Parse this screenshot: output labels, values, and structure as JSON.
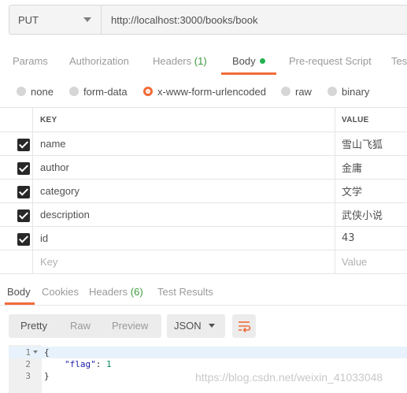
{
  "request": {
    "method": "PUT",
    "url": "http://localhost:3000/books/book"
  },
  "request_tabs": {
    "params": "Params",
    "authorization": "Authorization",
    "headers": "Headers",
    "headers_count": "(1)",
    "body": "Body",
    "prerequest": "Pre-request Script",
    "tests": "Tes"
  },
  "body_types": {
    "none": "none",
    "form_data": "form-data",
    "urlencoded": "x-www-form-urlencoded",
    "raw": "raw",
    "binary": "binary",
    "selected": "x-www-form-urlencoded"
  },
  "kv_table": {
    "key_header": "KEY",
    "value_header": "VALUE",
    "rows": [
      {
        "key": "name",
        "value": "雪山飞狐",
        "checked": true
      },
      {
        "key": "author",
        "value": "金庸",
        "checked": true
      },
      {
        "key": "category",
        "value": "文学",
        "checked": true
      },
      {
        "key": "description",
        "value": "武侠小说",
        "checked": true
      },
      {
        "key": "id",
        "value": "43",
        "checked": true
      }
    ],
    "placeholder_key": "Key",
    "placeholder_value": "Value"
  },
  "response_tabs": {
    "body": "Body",
    "cookies": "Cookies",
    "headers": "Headers",
    "headers_count": "(6)",
    "test_results": "Test Results"
  },
  "response_toolbar": {
    "pretty": "Pretty",
    "raw": "Raw",
    "preview": "Preview",
    "format": "JSON",
    "wrap_icon": "wrap-lines-icon"
  },
  "response_body": {
    "line_numbers": [
      "1",
      "2",
      "3"
    ],
    "open_brace": "{",
    "key": "\"flag\"",
    "colon": ": ",
    "value": "1",
    "close_brace": "}"
  },
  "watermark": "https://blog.csdn.net/weixin_41033048",
  "colors": {
    "accent": "#f26b3a",
    "count_green": "#3c9a3c",
    "dot_green": "#24b24f"
  }
}
